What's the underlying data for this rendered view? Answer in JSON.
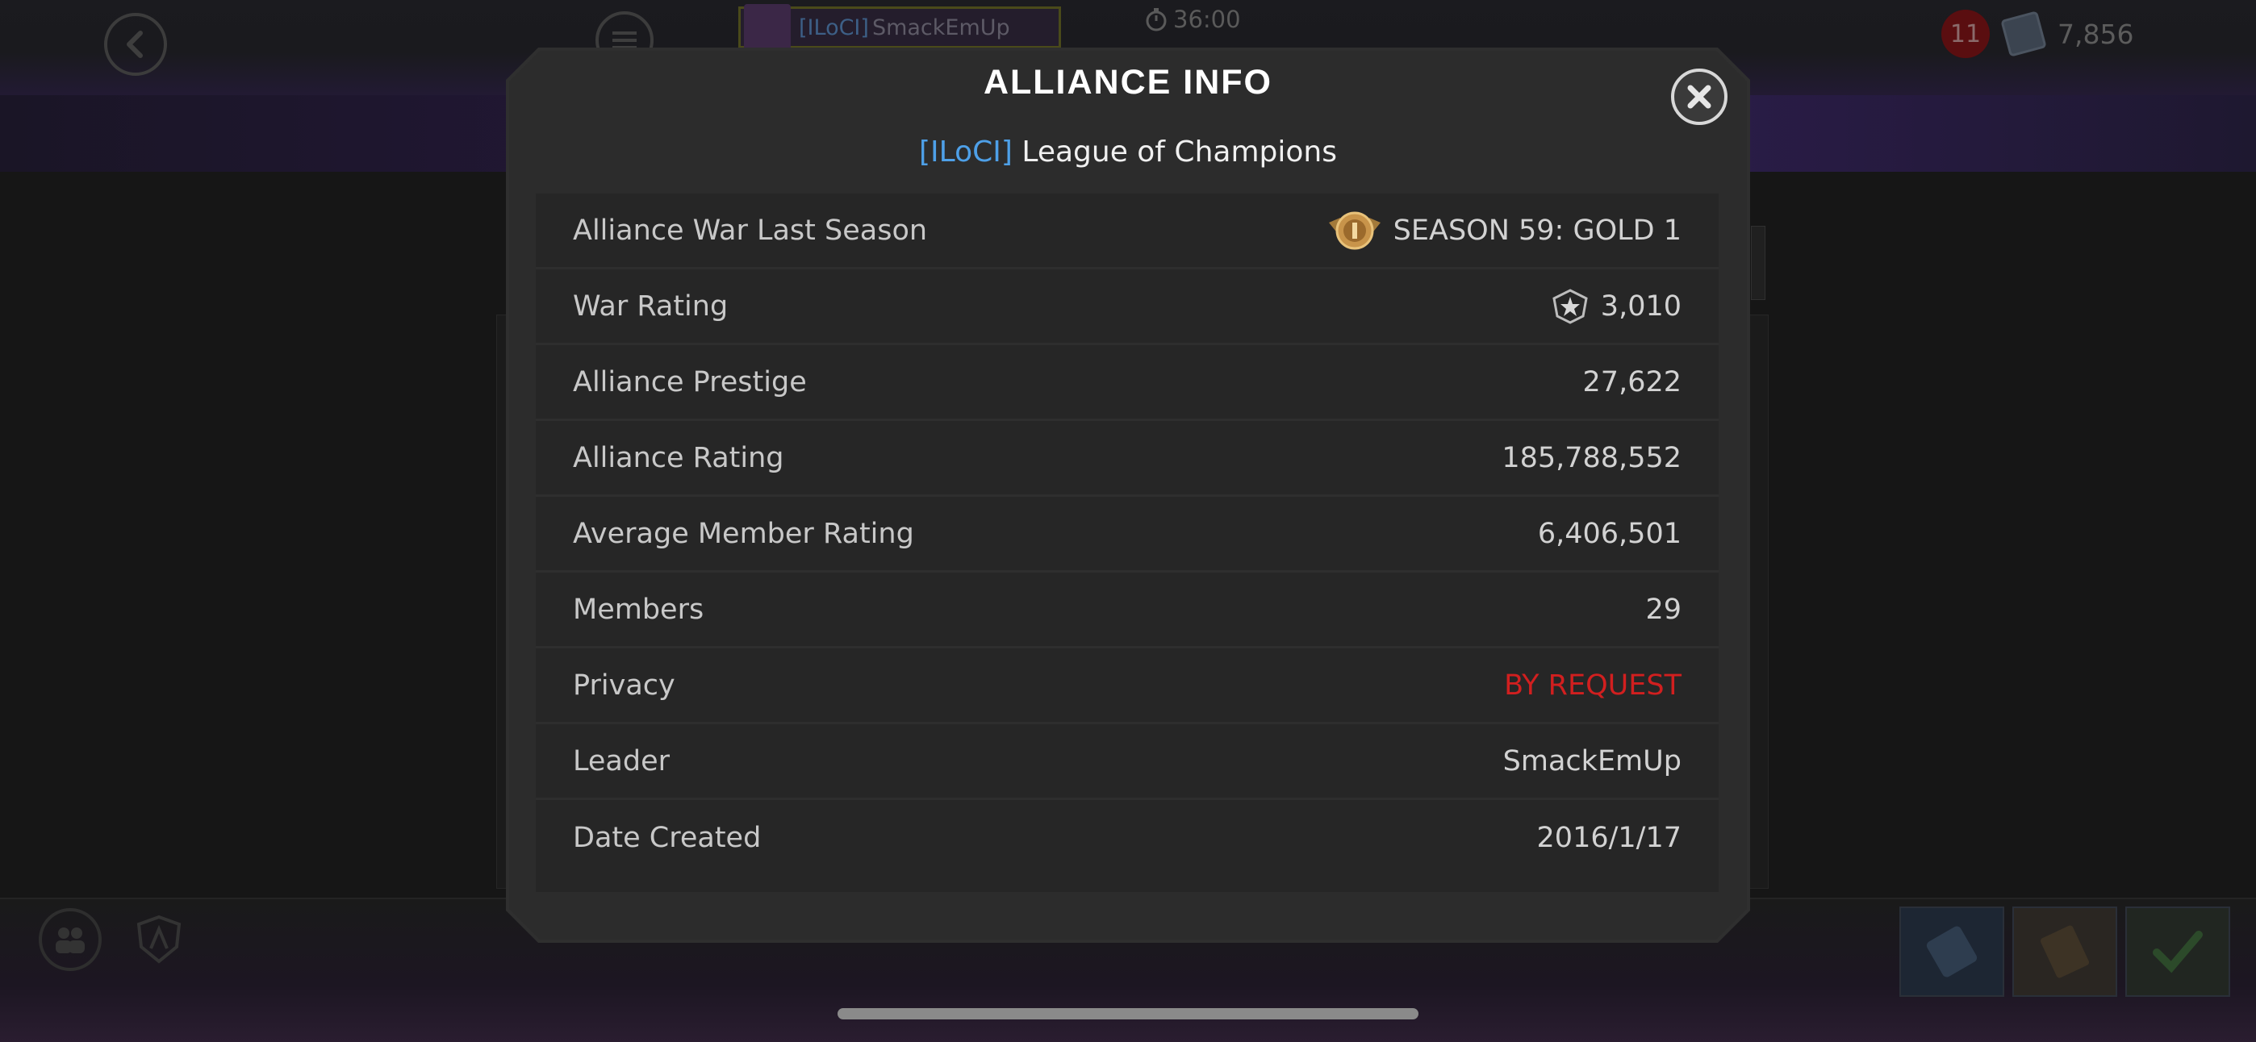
{
  "topbar": {
    "player_tag": "[ILoCI]",
    "player_name": "SmackEmUp",
    "timer": "36:00",
    "notification_count": "11",
    "currency_value": "7,856"
  },
  "modal": {
    "title": "ALLIANCE INFO",
    "alliance_tag": "[ILoCI]",
    "alliance_name": "League of Champions",
    "rows": [
      {
        "label": "Alliance War Last Season",
        "value": "SEASON 59: GOLD 1",
        "icon": "gold-tier-badge-icon"
      },
      {
        "label": "War Rating",
        "value": "3,010",
        "icon": "war-rating-star-icon"
      },
      {
        "label": "Alliance Prestige",
        "value": "27,622"
      },
      {
        "label": "Alliance Rating",
        "value": "185,788,552"
      },
      {
        "label": "Average Member Rating",
        "value": "6,406,501"
      },
      {
        "label": "Members",
        "value": "29"
      },
      {
        "label": "Privacy",
        "value": "BY REQUEST"
      },
      {
        "label": "Leader",
        "value": "SmackEmUp"
      },
      {
        "label": "Date Created",
        "value": "2016/1/17"
      }
    ]
  },
  "colors": {
    "accent_blue": "#4ea0e8",
    "danger_red": "#d11f1f",
    "panel": "#2c2c2c"
  }
}
